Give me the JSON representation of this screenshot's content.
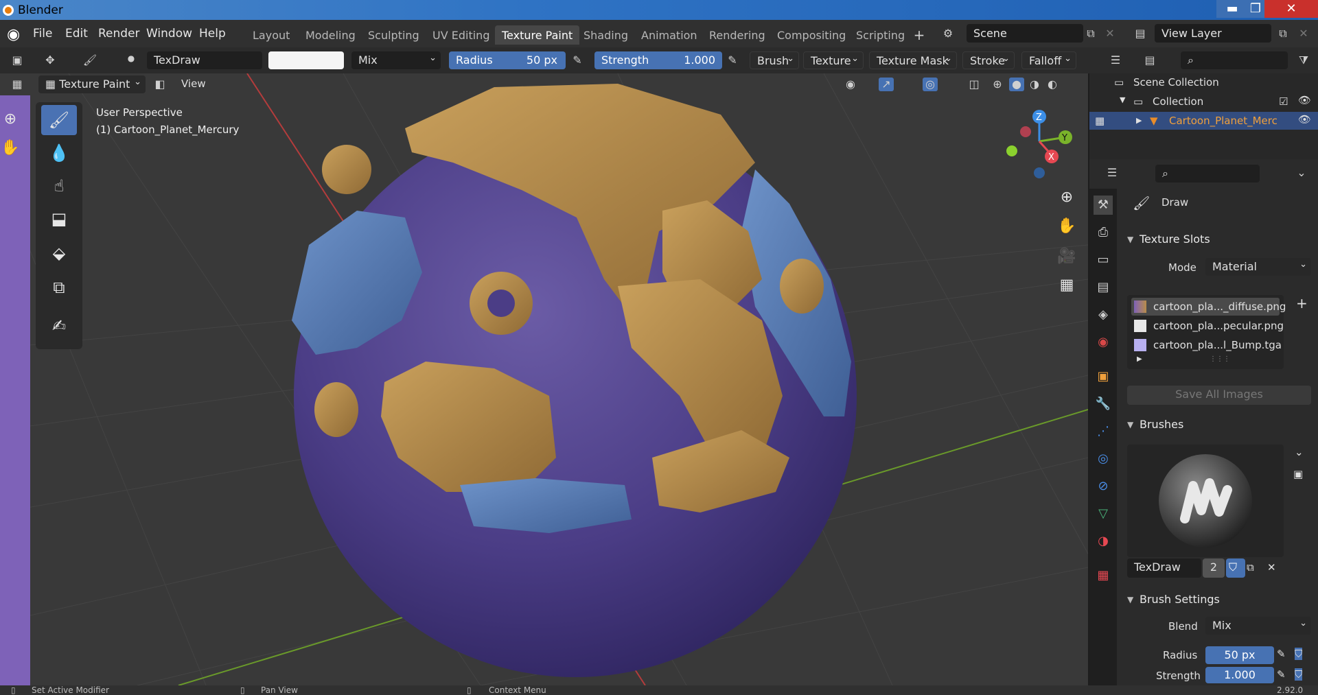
{
  "window": {
    "title": "Blender",
    "min": "▬",
    "max": "❐",
    "close": "✕"
  },
  "menu": [
    "File",
    "Edit",
    "Render",
    "Window",
    "Help"
  ],
  "workspaces": [
    "Layout",
    "Modeling",
    "Sculpting",
    "UV Editing",
    "Texture Paint",
    "Shading",
    "Animation",
    "Rendering",
    "Compositing",
    "Scripting"
  ],
  "active_workspace": "Texture Paint",
  "scene": "Scene",
  "view_layer": "View Layer",
  "toolhdr": {
    "brush_name": "TexDraw",
    "blend": "Mix",
    "radius_label": "Radius",
    "radius_value": "50 px",
    "strength_label": "Strength",
    "strength_value": "1.000",
    "menus": [
      "Brush",
      "Texture",
      "Texture Mask",
      "Stroke",
      "Falloff"
    ]
  },
  "viewport": {
    "mode": "Texture Paint",
    "view_menu": "View",
    "perspective": "User Perspective",
    "object": "(1) Cartoon_Planet_Mercury",
    "axis_z": "Z",
    "axis_y": "Y",
    "axis_x": "X"
  },
  "outliner": {
    "scene_collection": "Scene Collection",
    "collection": "Collection",
    "object": "Cartoon_Planet_Merc"
  },
  "properties": {
    "active_tool": "Draw",
    "texture_slots_title": "Texture Slots",
    "mode_label": "Mode",
    "mode_value": "Material",
    "slots": [
      "cartoon_pla..._diffuse.png",
      "cartoon_pla...pecular.png",
      "cartoon_pla...l_Bump.tga"
    ],
    "save_all": "Save All Images",
    "brushes_title": "Brushes",
    "brush_name": "TexDraw",
    "brush_users": "2",
    "brush_settings_title": "Brush Settings",
    "blend_label": "Blend",
    "blend_value": "Mix",
    "radius_label": "Radius",
    "radius_value": "50 px",
    "strength_label": "Strength",
    "strength_value": "1.000"
  },
  "status": {
    "left": "Set Active Modifier",
    "mid": "Pan View",
    "right": "Context Menu",
    "version": "2.92.0"
  },
  "colors": {
    "accent": "#4772b3",
    "planet": "#4e3f86",
    "land": "#b98d4a",
    "ice": "#5275ad",
    "purple_strip": "#7e62b8"
  }
}
